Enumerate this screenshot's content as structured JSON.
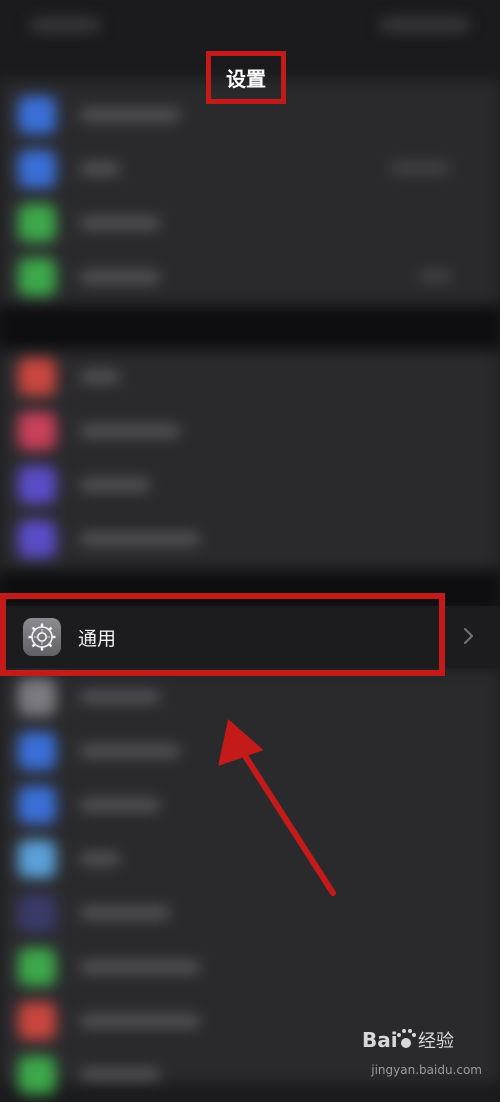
{
  "header": {
    "title": "设置"
  },
  "general_row": {
    "label": "通用",
    "icon": "gear-icon"
  },
  "watermark": {
    "brand": "Baidu经验",
    "domain": "jingyan.baidu.com"
  },
  "colors": {
    "highlight": "#c41a1a",
    "background": "#1b1b1d"
  }
}
